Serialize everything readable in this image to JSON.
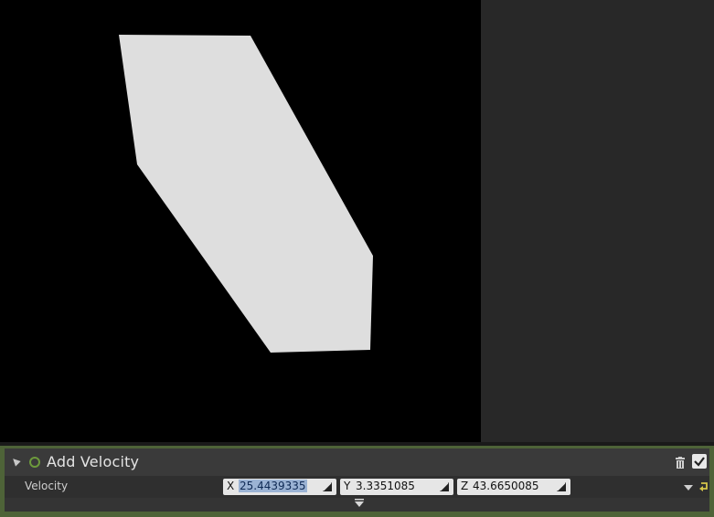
{
  "viewport": {
    "background": "#000000",
    "shape_fill": "#dedede"
  },
  "module": {
    "title": "Add Velocity",
    "accent": "#4e6338",
    "enabled_icon": "check-icon",
    "delete_icon": "trash-icon",
    "status_icon": "ring-icon"
  },
  "param": {
    "label": "Velocity",
    "x": {
      "axis": "X",
      "value": "25.4439335"
    },
    "y": {
      "axis": "Y",
      "value": "3.3351085"
    },
    "z": {
      "axis": "Z",
      "value": "43.6650085"
    },
    "options_icon": "dropdown-arrow-icon",
    "reset_icon": "reset-icon",
    "reset_color": "#d6c64a"
  },
  "footer": {
    "expand_icon": "expand-arrow-icon"
  }
}
